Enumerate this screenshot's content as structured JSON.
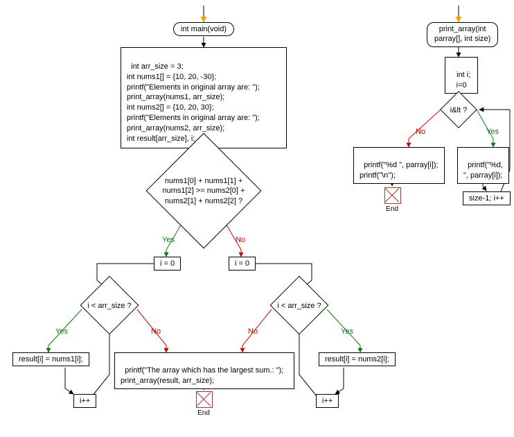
{
  "flowchart_main": {
    "start_label": "int main(void)",
    "init_block": "int arr_size = 3;\nint nums1[] = {10, 20, -30};\nprintf(\"Elements in original array are: \");\nprint_array(nums1, arr_size);\nint nums2[] = {10, 20, 30};\nprintf(\"Elements in original array are: \");\nprint_array(nums2, arr_size);\nint result[arr_size], i;",
    "cond_sum": "nums1[0] + nums1[1] +\nnums1[2] >= nums2[0] +\nnums2[1] + nums2[2] ?",
    "i_eq_0_left": "i = 0",
    "i_eq_0_right": "i = 0",
    "cond_left": "i < arr_size ?",
    "cond_right": "i < arr_size ?",
    "assign_left": "result[i] = nums1[i];",
    "assign_right": "result[i] = nums2[i];",
    "inc_left": "i++",
    "inc_right": "i++",
    "print_block": "printf(\"The array which has the largest sum.: \");\nprint_array(result, arr_size);",
    "end_label_left": "End",
    "end_label_right": "End"
  },
  "flowchart_sub": {
    "start_label": "print_array(int\nparray[], int size)",
    "init_block": "int i;\ni=0",
    "cond": "i&lt ?",
    "no_block": "printf(\"%d \", parray[i]);\nprintf(\"\\n\");",
    "yes_block": "printf(\"%d,\n\", parray[i]);",
    "loop_block": "size-1; i++",
    "end_label": "End"
  },
  "labels": {
    "yes": "Yes",
    "no": "No"
  }
}
